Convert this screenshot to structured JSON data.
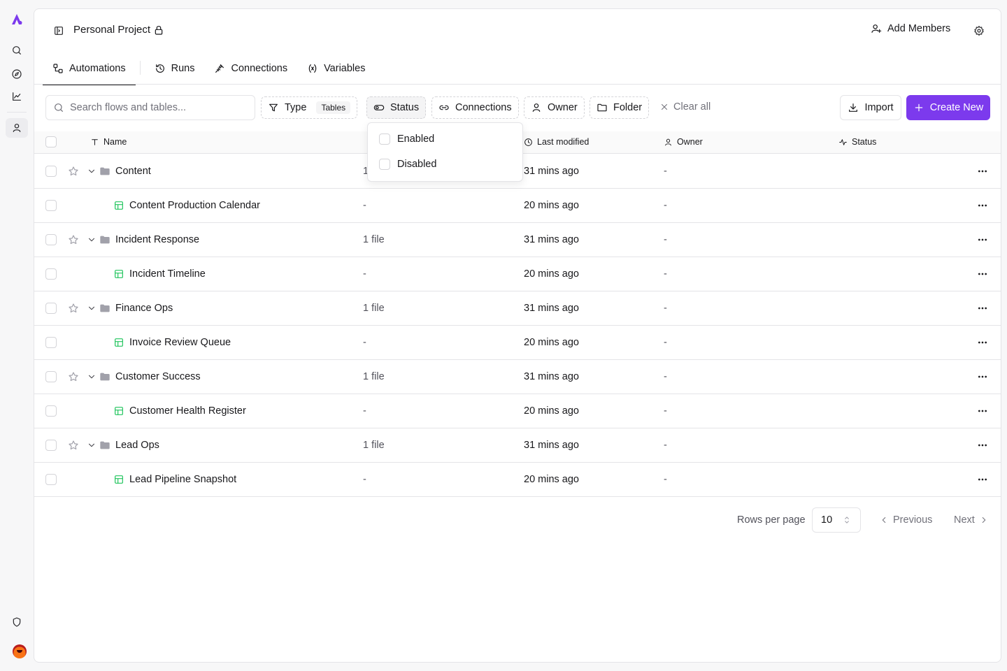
{
  "project": {
    "title": "Personal Project"
  },
  "header": {
    "add_members": "Add Members"
  },
  "tabs": [
    {
      "label": "Automations",
      "icon": "automations-icon",
      "active": true
    },
    {
      "label": "Runs",
      "icon": "history-icon"
    },
    {
      "label": "Connections",
      "icon": "plug-icon"
    },
    {
      "label": "Variables",
      "icon": "variable-icon"
    }
  ],
  "toolbar": {
    "search_placeholder": "Search flows and tables...",
    "filters": {
      "type": "Type",
      "type_badge": "Tables",
      "status": "Status",
      "connections": "Connections",
      "owner": "Owner",
      "folder": "Folder"
    },
    "clear_all": "Clear all",
    "import": "Import",
    "create_new": "Create New"
  },
  "status_dropdown": {
    "options": [
      "Enabled",
      "Disabled"
    ]
  },
  "table": {
    "columns": {
      "name": "Name",
      "last_modified": "Last modified",
      "owner": "Owner",
      "status": "Status"
    },
    "rows": [
      {
        "kind": "folder",
        "name": "Content",
        "detail": "1 file",
        "modified": "31 mins ago",
        "owner": "-"
      },
      {
        "kind": "table",
        "name": "Content Production Calendar",
        "detail": "-",
        "modified": "20 mins ago",
        "owner": "-"
      },
      {
        "kind": "folder",
        "name": "Incident Response",
        "detail": "1 file",
        "modified": "31 mins ago",
        "owner": "-"
      },
      {
        "kind": "table",
        "name": "Incident Timeline",
        "detail": "-",
        "modified": "20 mins ago",
        "owner": "-"
      },
      {
        "kind": "folder",
        "name": "Finance Ops",
        "detail": "1 file",
        "modified": "31 mins ago",
        "owner": "-"
      },
      {
        "kind": "table",
        "name": "Invoice Review Queue",
        "detail": "-",
        "modified": "20 mins ago",
        "owner": "-"
      },
      {
        "kind": "folder",
        "name": "Customer Success",
        "detail": "1 file",
        "modified": "31 mins ago",
        "owner": "-"
      },
      {
        "kind": "table",
        "name": "Customer Health Register",
        "detail": "-",
        "modified": "20 mins ago",
        "owner": "-"
      },
      {
        "kind": "folder",
        "name": "Lead Ops",
        "detail": "1 file",
        "modified": "31 mins ago",
        "owner": "-"
      },
      {
        "kind": "table",
        "name": "Lead Pipeline Snapshot",
        "detail": "-",
        "modified": "20 mins ago",
        "owner": "-"
      }
    ]
  },
  "pagination": {
    "rows_per_page_label": "Rows per page",
    "rows_per_page": "10",
    "previous": "Previous",
    "next": "Next"
  },
  "colors": {
    "accent": "#7c3aed",
    "table_icon": "#22c55e",
    "folder": "#a1a1aa"
  }
}
